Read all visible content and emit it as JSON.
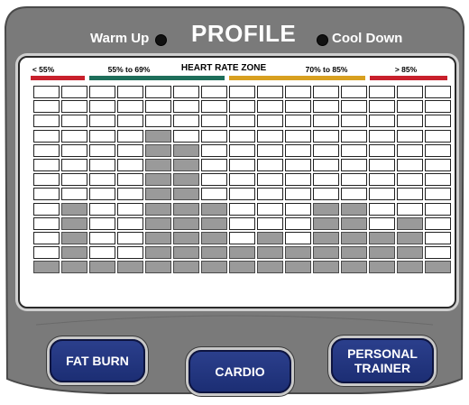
{
  "header": {
    "title": "PROFILE",
    "warm_up_label": "Warm Up",
    "cool_down_label": "Cool Down"
  },
  "zones": {
    "heading": "HEART RATE ZONE",
    "items": [
      {
        "label": "< 55%",
        "color": "#c8202c"
      },
      {
        "label": "55% to 69%",
        "color": "#1e6e5a"
      },
      {
        "label": "70% to 85%",
        "color": "#d8a020"
      },
      {
        "label": "> 85%",
        "color": "#c8202c"
      }
    ]
  },
  "profile_levels": [
    0,
    4,
    0,
    0,
    9,
    8,
    4,
    1,
    2,
    1,
    4,
    4,
    2,
    3,
    0
  ],
  "buttons": {
    "fat_burn": "FAT BURN",
    "cardio": "CARDIO",
    "personal_trainer_line1": "PERSONAL",
    "personal_trainer_line2": "TRAINER"
  },
  "colors": {
    "console_body": "#7a7a7a",
    "button_blue": "#233580",
    "lit_cell": "#9a9a9a"
  }
}
